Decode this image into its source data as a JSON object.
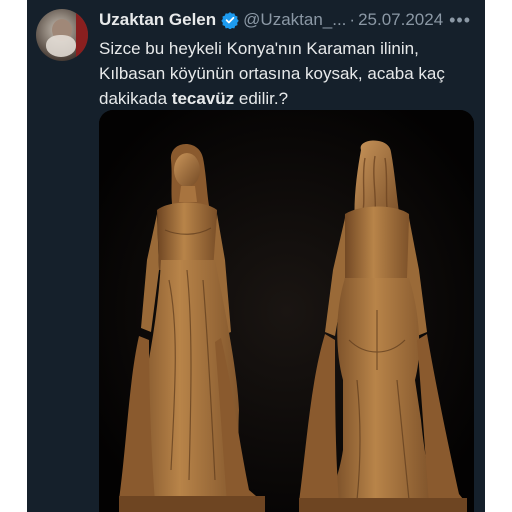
{
  "tweet": {
    "display_name": "Uzaktan Gelen",
    "handle": "@Uzaktan_...",
    "separator": "·",
    "date": "25.07.2024",
    "more_icon": "more-horizontal-icon",
    "text_before_bold": "Sizce bu heykeli Konya'nın Karaman ilinin, Kılbasan köyünün ortasına koysak, acaba kaç dakikada ",
    "text_bold": "tecavüz",
    "text_after_bold": " edilir.?"
  },
  "colors": {
    "background": "#15202b",
    "primary_text": "#e7e9ea",
    "secondary_text": "#8b98a5",
    "verified_badge": "#1d9bf0",
    "statue_bronze": "#a8743f"
  }
}
